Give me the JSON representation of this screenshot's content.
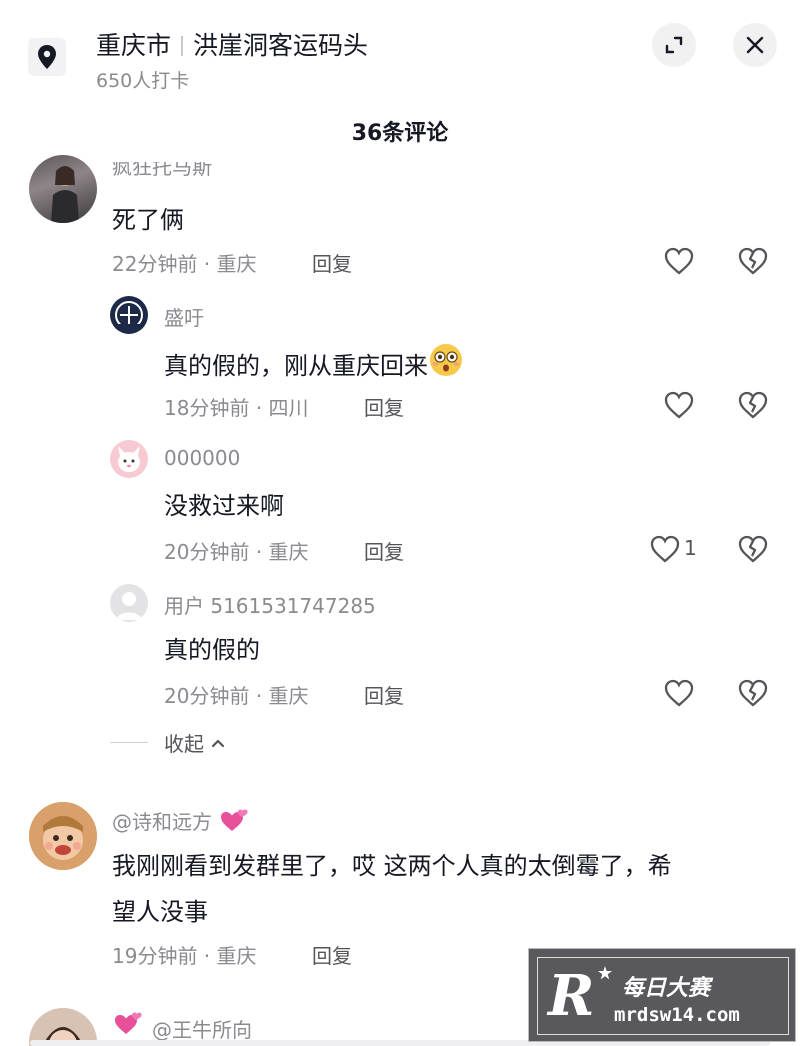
{
  "header": {
    "city": "重庆市",
    "place": "洪崖洞客运码头",
    "checkins": "650人打卡",
    "expand_icon": "expand-icon",
    "close_icon": "close-icon"
  },
  "comments_title": "36条评论",
  "comments": [
    {
      "user": "疯狂托马斯",
      "text": "死了俩",
      "meta": "22分钟前 · 重庆",
      "reply": "回复"
    },
    {
      "user": "盛吁",
      "text": "真的假的，刚从重庆回来",
      "meta": "18分钟前 · 四川",
      "reply": "回复"
    },
    {
      "user": "000000",
      "text": "没救过来啊",
      "meta": "20分钟前 · 重庆",
      "reply": "回复",
      "likes": "1"
    },
    {
      "user": "用户 5161531747285",
      "text": "真的假的",
      "meta": "20分钟前 · 重庆",
      "reply": "回复"
    },
    {
      "user": "@诗和远方",
      "text_line1": "我刚刚看到发群里了，哎 这两个人真的太倒霉了，希",
      "text_line2": "望人没事",
      "meta": "19分钟前 · 重庆",
      "reply": "回复"
    }
  ],
  "collapse_label": "收起",
  "partial_user": "@王牛所向",
  "watermark": {
    "logo": "R",
    "name": "每日大赛",
    "url": "mrdsw14.com"
  },
  "colors": {
    "text_primary": "#161823",
    "text_secondary": "#8a8b91",
    "icon_grey": "#545559"
  }
}
